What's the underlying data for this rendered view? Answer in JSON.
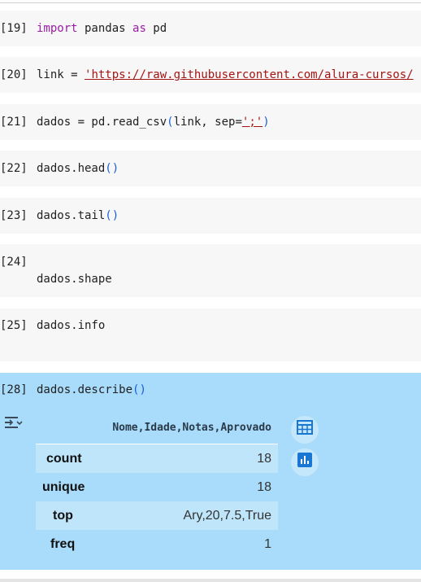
{
  "cells": [
    {
      "prompt": "[19]",
      "code": [
        {
          "t": "import",
          "c": "kw"
        },
        {
          "t": " pandas "
        },
        {
          "t": "as",
          "c": "kw"
        },
        {
          "t": " pd"
        }
      ]
    },
    {
      "prompt": "[20]",
      "code": [
        {
          "t": "link = "
        },
        {
          "t": "'https://raw.githubusercontent.com/alura-cursos/",
          "c": "str"
        }
      ]
    },
    {
      "prompt": "[21]",
      "code": [
        {
          "t": "dados = pd.read_csv"
        },
        {
          "t": "(",
          "c": "br"
        },
        {
          "t": "link, sep="
        },
        {
          "t": "';'",
          "c": "str"
        },
        {
          "t": ")",
          "c": "br"
        }
      ]
    },
    {
      "prompt": "[22]",
      "code": [
        {
          "t": "dados.head"
        },
        {
          "t": "()",
          "c": "br"
        }
      ]
    },
    {
      "prompt": "[23]",
      "code": [
        {
          "t": "dados.tail"
        },
        {
          "t": "()",
          "c": "br"
        }
      ]
    },
    {
      "prompt": "[24]",
      "code": [
        {
          "t": "dados.shape"
        }
      ]
    },
    {
      "prompt": "[25]",
      "code": [
        {
          "t": "dados.info"
        }
      ]
    },
    {
      "prompt": "[28]",
      "code": [
        {
          "t": "dados.describe"
        },
        {
          "t": "()",
          "c": "br"
        }
      ]
    }
  ],
  "output": {
    "header": "Nome,Idade,Notas,Aprovado",
    "rows": [
      {
        "label": "count",
        "value": "18"
      },
      {
        "label": "unique",
        "value": "18"
      },
      {
        "label": "top",
        "value": "Ary,20,7.5,True"
      },
      {
        "label": "freq",
        "value": "1"
      }
    ]
  },
  "icons": {
    "output_toggle": "output-collapse-icon",
    "table_view": "table-icon",
    "chart_suggest": "bar-chart-icon"
  },
  "colors": {
    "selected_cell_bg": "#a8dcfa",
    "cell_bg": "#f7f7f7",
    "keyword": "#9a1da8",
    "string": "#a31515",
    "bracket": "#1a5fd6",
    "chart_button": "#1976d2"
  }
}
